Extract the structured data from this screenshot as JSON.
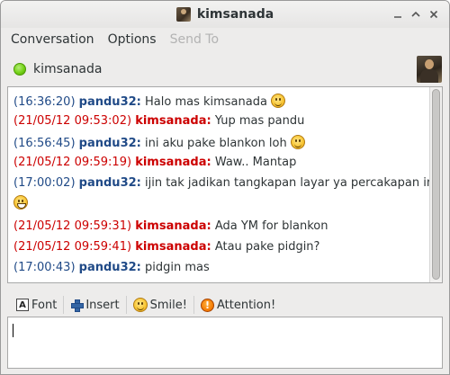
{
  "window": {
    "title": "kimsanada"
  },
  "menu": {
    "items": [
      "Conversation",
      "Options",
      "Send To"
    ]
  },
  "buddy": {
    "name": "kimsanada",
    "status": "available"
  },
  "messages": [
    {
      "time": "(16:36:20)",
      "sender": "pandu32:",
      "text": "Halo mas kimsanada",
      "side": "local",
      "emoticon": "smile-icon"
    },
    {
      "time": "(21/05/12 09:53:02)",
      "sender": "kimsanada:",
      "text": "Yup mas pandu",
      "side": "remote"
    },
    {
      "time": "(16:56:45)",
      "sender": "pandu32:",
      "text": "ini aku pake blankon loh",
      "side": "local",
      "emoticon": "smile-icon"
    },
    {
      "time": "(21/05/12 09:59:19)",
      "sender": "kimsanada:",
      "text": "Waw.. Mantap",
      "side": "remote"
    },
    {
      "time": "(17:00:02)",
      "sender": "pandu32:",
      "text": "ijin tak jadikan tangkapan layar ya percakapan ini",
      "side": "local",
      "emoticon": "grin-icon"
    },
    {
      "time": "(21/05/12 09:59:31)",
      "sender": "kimsanada:",
      "text": "Ada YM for blankon",
      "side": "remote"
    },
    {
      "time": "(21/05/12 09:59:41)",
      "sender": "kimsanada:",
      "text": "Atau pake pidgin?",
      "side": "remote"
    },
    {
      "time": "(17:00:43)",
      "sender": "pandu32:",
      "text": "pidgin mas",
      "side": "local"
    }
  ],
  "toolbar": {
    "font_label": "Font",
    "insert_label": "Insert",
    "smile_label": "Smile!",
    "attention_label": "Attention!"
  },
  "colors": {
    "local": "#204a87",
    "remote": "#cc0000",
    "status_available": "#73d216"
  }
}
